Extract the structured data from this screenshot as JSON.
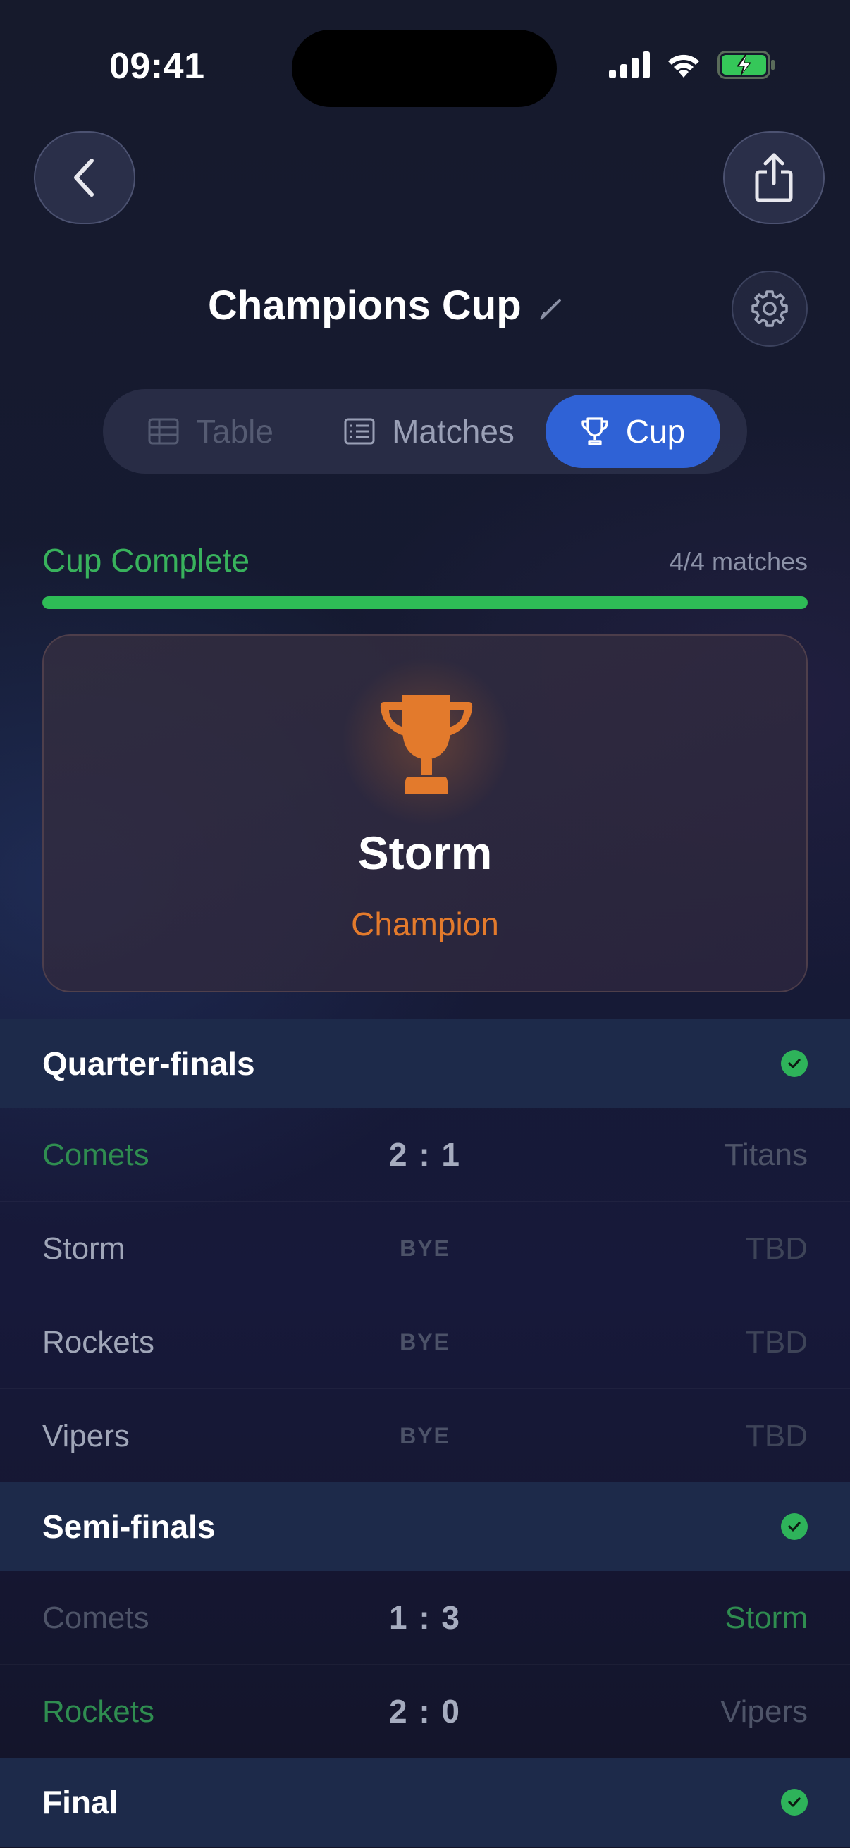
{
  "status_bar": {
    "time": "09:41"
  },
  "header": {
    "title": "Champions Cup"
  },
  "tabs": [
    {
      "label": "Table",
      "icon": "table-icon",
      "active": false
    },
    {
      "label": "Matches",
      "icon": "list-icon",
      "active": false
    },
    {
      "label": "Cup",
      "icon": "trophy-icon",
      "active": true
    }
  ],
  "progress": {
    "label": "Cup Complete",
    "count": "4/4 matches",
    "fraction": 1.0,
    "color": "#2ebc56"
  },
  "champion": {
    "name": "Storm",
    "label": "Champion",
    "accent": "#e37a2c"
  },
  "rounds": [
    {
      "title": "Quarter-finals",
      "complete": true,
      "matches": [
        {
          "home": "Comets",
          "score": "2 : 1",
          "away": "Titans",
          "winner": "home"
        },
        {
          "home": "Storm",
          "score": "BYE",
          "away": "TBD",
          "winner": "bye"
        },
        {
          "home": "Rockets",
          "score": "BYE",
          "away": "TBD",
          "winner": "bye"
        },
        {
          "home": "Vipers",
          "score": "BYE",
          "away": "TBD",
          "winner": "bye"
        }
      ]
    },
    {
      "title": "Semi-finals",
      "complete": true,
      "matches": [
        {
          "home": "Comets",
          "score": "1 : 3",
          "away": "Storm",
          "winner": "away"
        },
        {
          "home": "Rockets",
          "score": "2 : 0",
          "away": "Vipers",
          "winner": "home"
        }
      ]
    },
    {
      "title": "Final",
      "complete": true,
      "matches": []
    }
  ]
}
